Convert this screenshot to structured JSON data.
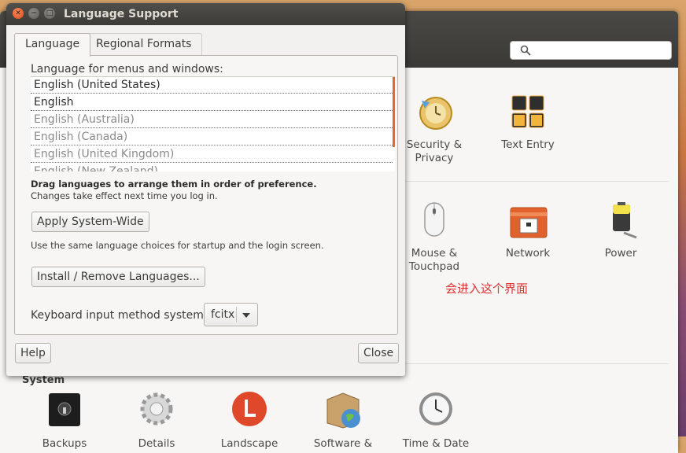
{
  "dialog": {
    "title": "Language Support",
    "tabs": [
      "Language",
      "Regional Formats"
    ],
    "list_label": "Language for menus and windows:",
    "languages": [
      "English (United States)",
      "English",
      "English (Australia)",
      "English (Canada)",
      "English (United Kingdom)",
      "English (New Zealand)"
    ],
    "drag_hint": "Drag languages to arrange them in order of preference.",
    "effect_hint": "Changes take effect next time you log in.",
    "apply_button": "Apply System-Wide",
    "apply_hint": "Use the same language choices for startup and the login screen.",
    "install_button": "Install / Remove Languages...",
    "keyboard_label": "Keyboard input method system:",
    "keyboard_value": "fcitx",
    "help_button": "Help",
    "close_button": "Close"
  },
  "settings": {
    "items_row1": [
      "Security & Privacy",
      "Text Entry"
    ],
    "items_row2": [
      "Mouse & Touchpad",
      "Network",
      "Power"
    ],
    "section_system": "System",
    "items_system": [
      "Backups",
      "Details",
      "Landscape",
      "Software &",
      "Time & Date"
    ],
    "annotation": "会进入这个界面"
  },
  "colors": {
    "accent": "#e26b2c",
    "annotation": "#dd3333"
  }
}
